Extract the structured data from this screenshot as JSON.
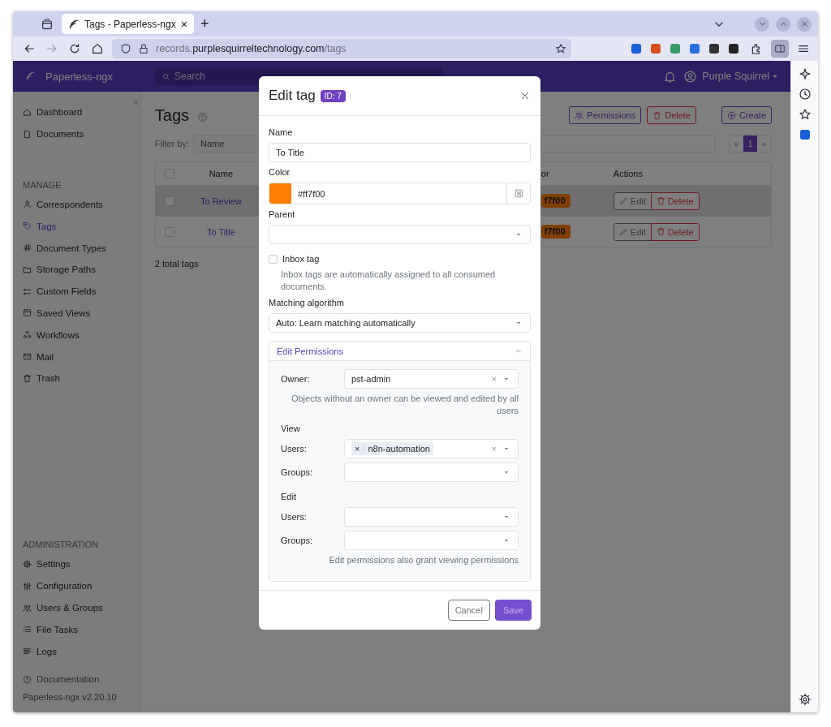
{
  "browser": {
    "tab_title": "Tags - Paperless-ngx",
    "tab_close": "×",
    "new_tab": "+",
    "url": "records.**purplesquirreltechnology.com**/tags"
  },
  "header": {
    "brand": "Paperless-ngx",
    "search_placeholder": "Search",
    "user": "Purple Squirrel"
  },
  "sidebar": {
    "top": [
      {
        "label": "Dashboard",
        "selected": false
      },
      {
        "label": "Documents",
        "selected": false
      }
    ],
    "manage": {
      "heading": "MANAGE",
      "items": [
        {
          "label": "Correspondents",
          "selected": false
        },
        {
          "label": "Tags",
          "selected": true
        },
        {
          "label": "Document Types",
          "selected": false
        },
        {
          "label": "Storage Paths",
          "selected": false
        },
        {
          "label": "Custom Fields",
          "selected": false
        },
        {
          "label": "Saved Views",
          "selected": false
        },
        {
          "label": "Workflows",
          "selected": false
        },
        {
          "label": "Mail",
          "selected": false
        },
        {
          "label": "Trash",
          "selected": false
        }
      ]
    },
    "admin": {
      "heading": "ADMINISTRATION",
      "items": [
        {
          "label": "Settings",
          "selected": false
        },
        {
          "label": "Configuration",
          "selected": false
        },
        {
          "label": "Users & Groups",
          "selected": false
        },
        {
          "label": "File Tasks",
          "selected": false
        },
        {
          "label": "Logs",
          "selected": false
        }
      ]
    },
    "documentation": "Documentation",
    "version": "Paperless-ngx v2.20.10",
    "collapse": "«"
  },
  "page": {
    "title": "Tags",
    "buttons": [
      "Permissions",
      "Delete",
      "Create"
    ],
    "filter_label": "Filter by:",
    "filter_placeholder": "Name",
    "pagination": [
      {
        "label": "«",
        "selected": false
      },
      {
        "label": "1",
        "selected": true
      },
      {
        "label": "»",
        "selected": false
      }
    ],
    "table": {
      "columns": [
        "Name",
        "or",
        "Actions"
      ],
      "all_checked": false,
      "rows": [
        {
          "name": "To Review",
          "color": "#7f3f00",
          "badge": "f7f00",
          "hovered": true,
          "checked": false,
          "actions": [
            "Edit",
            "Delete"
          ]
        },
        {
          "name": "To Title",
          "color": "#7f3f00",
          "badge": "f7f00",
          "hovered": false,
          "checked": false,
          "actions": [
            "Edit",
            "Delete"
          ]
        }
      ]
    },
    "total": "2 total tags"
  },
  "modal": {
    "title": "Edit tag",
    "badge": "ID: 7",
    "name": {
      "label": "Name",
      "value": "To Title"
    },
    "color": {
      "label": "Color",
      "value": "#ff7f00"
    },
    "parent": {
      "label": "Parent"
    },
    "inbox": {
      "label": "Inbox tag",
      "checked": false,
      "hint": "Inbox tags are automatically assigned to all consumed documents."
    },
    "matching": {
      "label": "Matching algorithm",
      "value": "Auto: Learn matching automatically"
    },
    "permissions": {
      "title": "Edit Permissions",
      "expanded": true,
      "owner_label": "Owner:",
      "owner": "pst-admin",
      "clear": "×",
      "owner_note": "Objects without an owner can be viewed and edited by all users",
      "view": {
        "heading": "View",
        "users_label": "Users:",
        "users": [
          {
            "name": "n8n-automation",
            "remove": "×"
          }
        ],
        "clear": "×",
        "groups_label": "Groups:"
      },
      "edit": {
        "heading": "Edit",
        "users_label": "Users:",
        "groups_label": "Groups:"
      },
      "edit_note": "Edit permissions also grant viewing permissions"
    },
    "cancel": "Cancel",
    "save": {
      "label": "Save",
      "disabled": true
    }
  }
}
